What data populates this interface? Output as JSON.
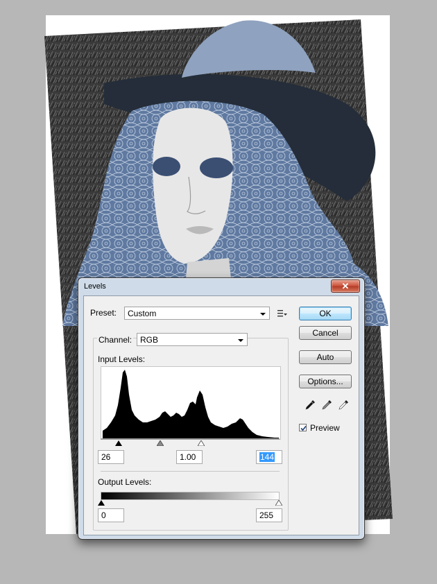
{
  "dialog": {
    "title": "Levels",
    "close_glyph": "✕",
    "preset": {
      "label": "Preset:",
      "value": "Custom"
    },
    "channel": {
      "label": "Channel:",
      "value": "RGB"
    },
    "input_levels": {
      "label": "Input Levels:",
      "black": "26",
      "gamma": "1.00",
      "white": "144"
    },
    "output_levels": {
      "label": "Output Levels:",
      "black": "0",
      "white": "255"
    },
    "buttons": {
      "ok": "OK",
      "cancel": "Cancel",
      "auto": "Auto",
      "options": "Options..."
    },
    "preview": {
      "label": "Preview",
      "checked": true
    },
    "icons": {
      "preset_menu": "preset-menu-icon",
      "black_dropper": "black-eyedropper-icon",
      "gray_dropper": "gray-eyedropper-icon",
      "white_dropper": "white-eyedropper-icon"
    },
    "colors": {
      "frame": "#cfdbe8",
      "close": "#c9503a",
      "selection": "#3399ff"
    }
  }
}
